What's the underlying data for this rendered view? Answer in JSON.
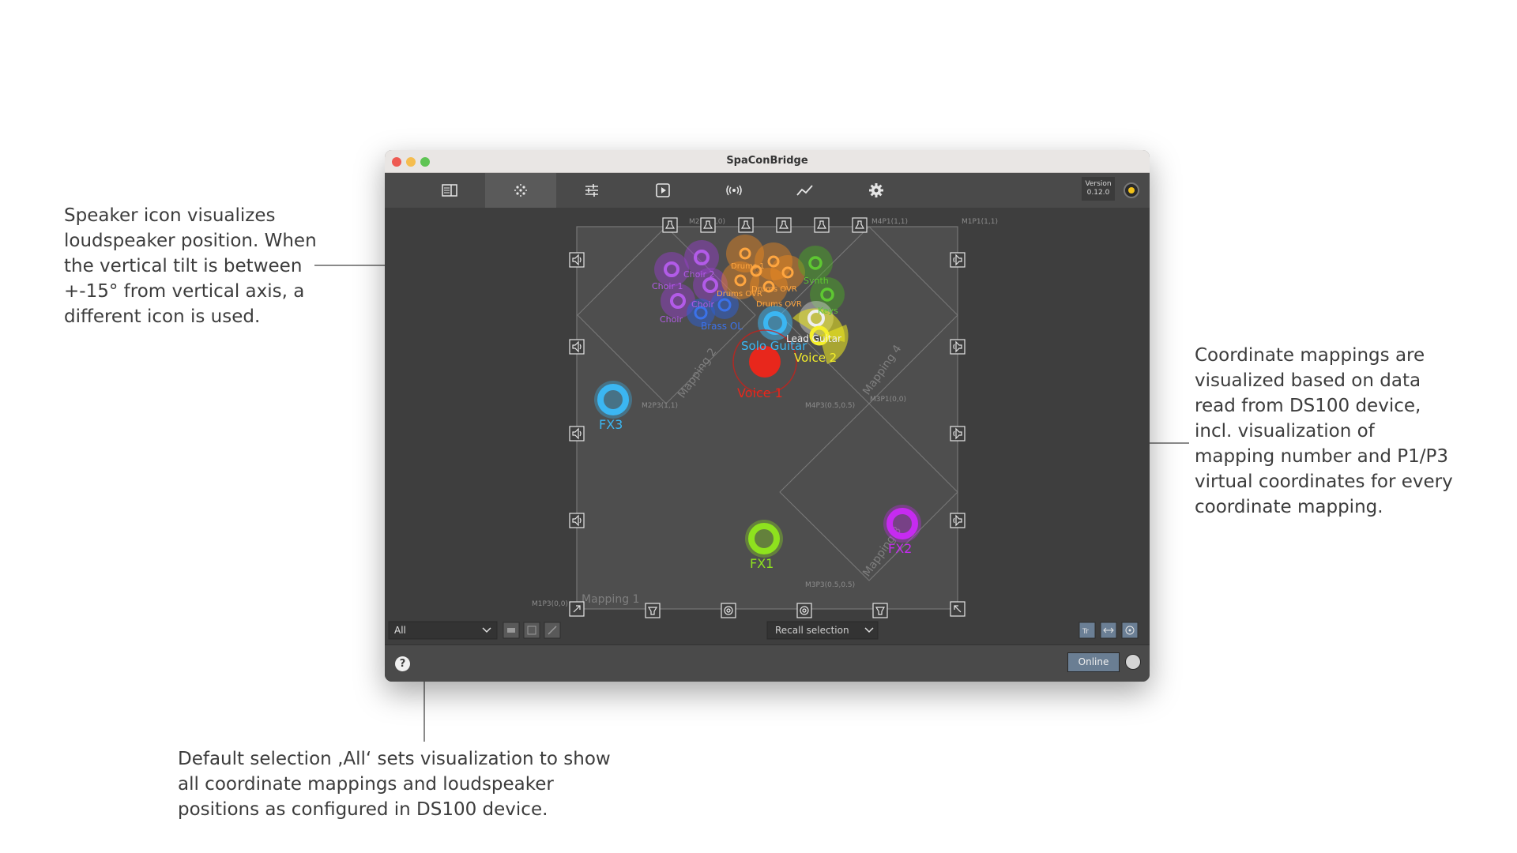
{
  "annotations": {
    "speaker_icon": "Speaker icon visualizes\nloudspeaker position. When\nthe vertical tilt is between\n+-15° from vertical axis, a\ndifferent icon is used.",
    "mappings": "Coordinate mappings are\nvisualized based on data\nread from DS100 device,\nincl. visualization of\nmapping number and P1/P3\nvirtual coordinates for every\ncoordinate mapping.",
    "default_selection": "Default selection ‚All‘ sets visualization to show\nall coordinate mappings and loudspeaker\npositions as configured in DS100 device."
  },
  "window": {
    "title": "SpaConBridge"
  },
  "toolbar": {
    "tabs": [
      {
        "icon": "table-view-icon"
      },
      {
        "icon": "multislider-icon"
      },
      {
        "icon": "mixer-sliders-icon"
      },
      {
        "icon": "play-scenes-icon"
      },
      {
        "icon": "enspace-icon"
      },
      {
        "icon": "statistics-icon"
      },
      {
        "icon": "gear-icon"
      }
    ],
    "version_label": "Version",
    "version_number": "0.12.0"
  },
  "mapping_labels": {
    "m2p1": "M2P1(0,0)",
    "m4p1": "M4P1(1,1)",
    "m1p1": "M1P1(1,1)",
    "m2p3": "M2P3(1,1)",
    "m4p3": "M4P3(0.5,0.5)",
    "m3p1": "M3P1(0,0)",
    "m3p3": "M3P3(0.5,0.5)",
    "m1p3": "M1P3(0,0)",
    "mapping1": "Mapping 1",
    "mapping2": "Mapping 2",
    "mapping3": "Mapping 3",
    "mapping4": "Mapping 4"
  },
  "sources": [
    {
      "name": "Choir 1",
      "color": "#9a3fd0"
    },
    {
      "name": "Choir 2",
      "color": "#9a3fd0"
    },
    {
      "name": "Choir 3",
      "color": "#9a3fd0"
    },
    {
      "name": "Choir 4",
      "color": "#9a3fd0"
    },
    {
      "name": "Drums 1",
      "color": "#f08a20"
    },
    {
      "name": "Drums OVR",
      "color": "#f08a20"
    },
    {
      "name": "Synth",
      "color": "#4caf24"
    },
    {
      "name": "Keys",
      "color": "#4caf24"
    },
    {
      "name": "Brass OL",
      "color": "#2b5fd6"
    },
    {
      "name": "Solo Guitar",
      "color": "#3bb6f2"
    },
    {
      "name": "Lead Guitar",
      "color": "#e8e8e8"
    },
    {
      "name": "Voice 2",
      "color": "#f2ec1e"
    },
    {
      "name": "Voice 1",
      "color": "#e8271c"
    },
    {
      "name": "FX3",
      "color": "#3bb6f2"
    },
    {
      "name": "FX1",
      "color": "#8ee21e"
    },
    {
      "name": "FX2",
      "color": "#c62bf0"
    }
  ],
  "visible_labels": {
    "choir_a": "Choir 1",
    "choir_b": "Choir 2",
    "choir_c": "Choir",
    "choir_d": "Choir",
    "drums_a": "Drums 1",
    "drums_b": "Drums OVR",
    "drums_c": "Drums OVR",
    "drums_d": "Drums OVR",
    "synth": "Synth",
    "keys": "Keys",
    "brass": "Brass OL",
    "solo_guitar": "Solo Guitar",
    "lead_guitar": "Lead Guitar",
    "voice2": "Voice 2",
    "voice1": "Voice 1",
    "fx3": "FX3",
    "fx1": "FX1",
    "fx2": "FX2"
  },
  "bottom": {
    "selection_value": "All",
    "recall_label": "Recall selection",
    "online_label": "Online",
    "help_icon": "question-icon"
  },
  "colors": {
    "online_button": "#6a7e93",
    "canvas": "#3e3e3e",
    "area": "#4e4e4e"
  }
}
